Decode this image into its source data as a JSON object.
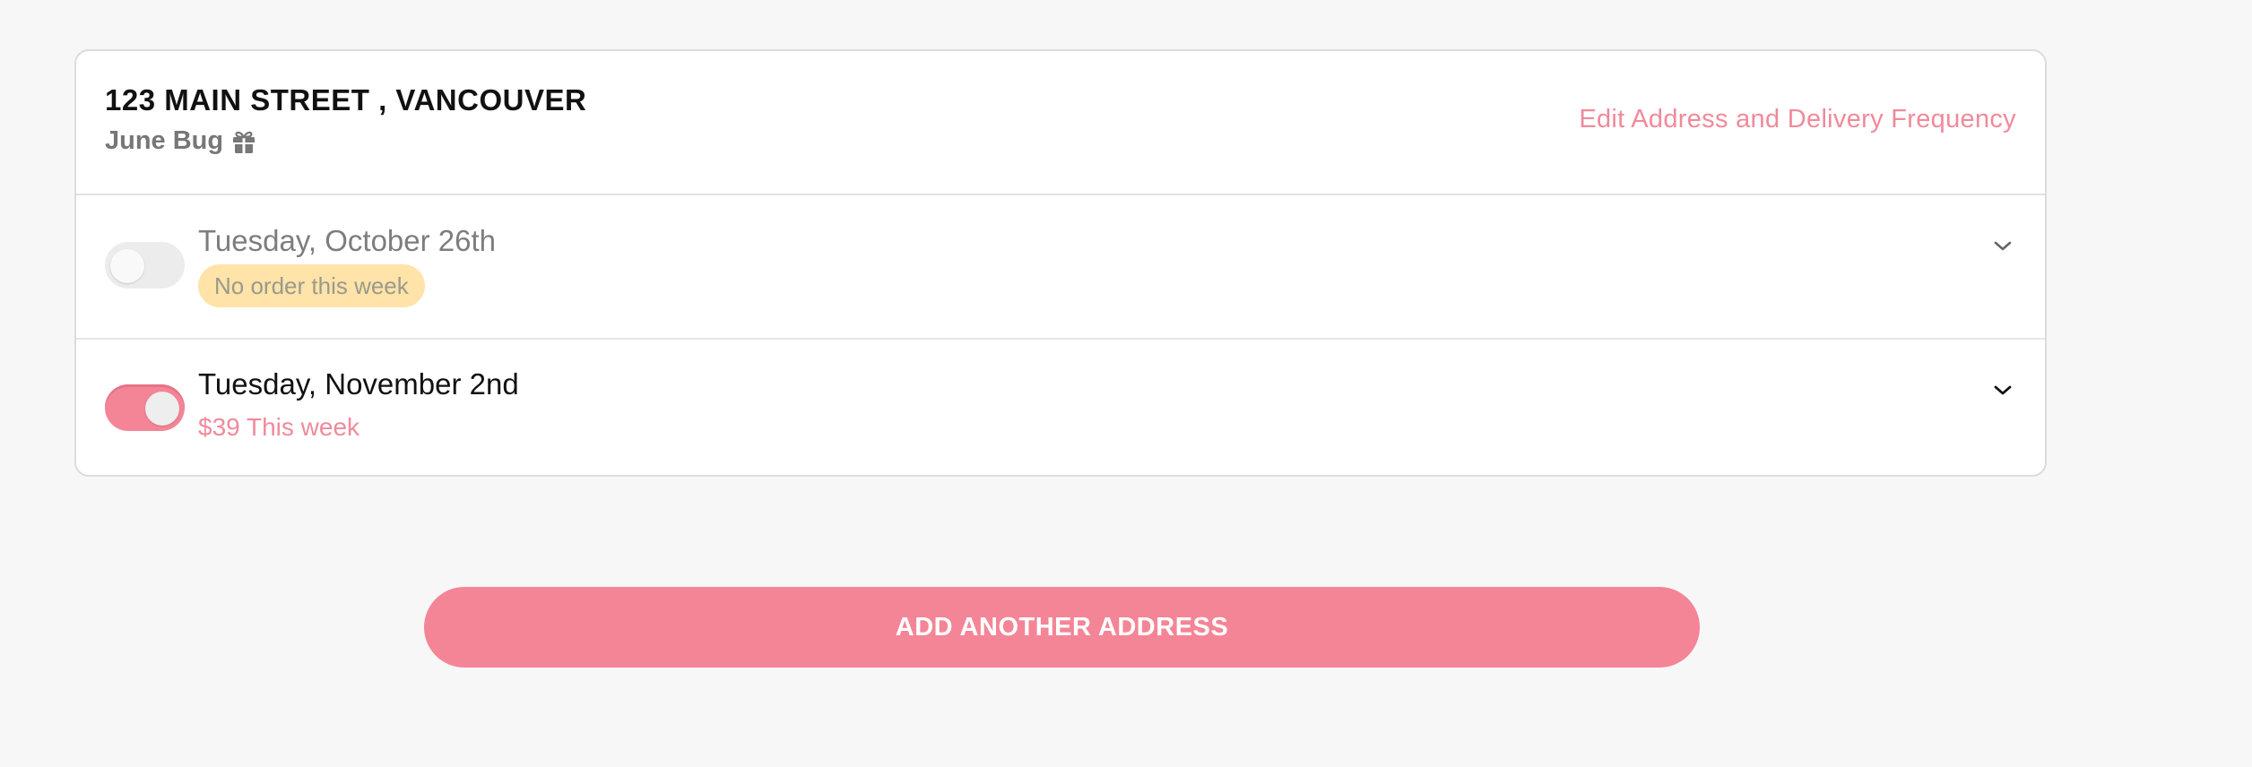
{
  "address": {
    "title": "123 MAIN STREET , VANCOUVER",
    "plan_name": "June Bug",
    "plan_icon": "gift-icon",
    "edit_label": "Edit Address and Delivery Frequency"
  },
  "deliveries": [
    {
      "date": "Tuesday, October 26th",
      "enabled": false,
      "status": "No order this week",
      "status_color": "#ffe3a8"
    },
    {
      "date": "Tuesday, November 2nd",
      "enabled": true,
      "status": "$39 This week",
      "status_color": "#f08a9b"
    }
  ],
  "actions": {
    "add_address_label": "ADD ANOTHER ADDRESS"
  },
  "colors": {
    "accent": "#f48596",
    "background": "#f7f7f7"
  }
}
